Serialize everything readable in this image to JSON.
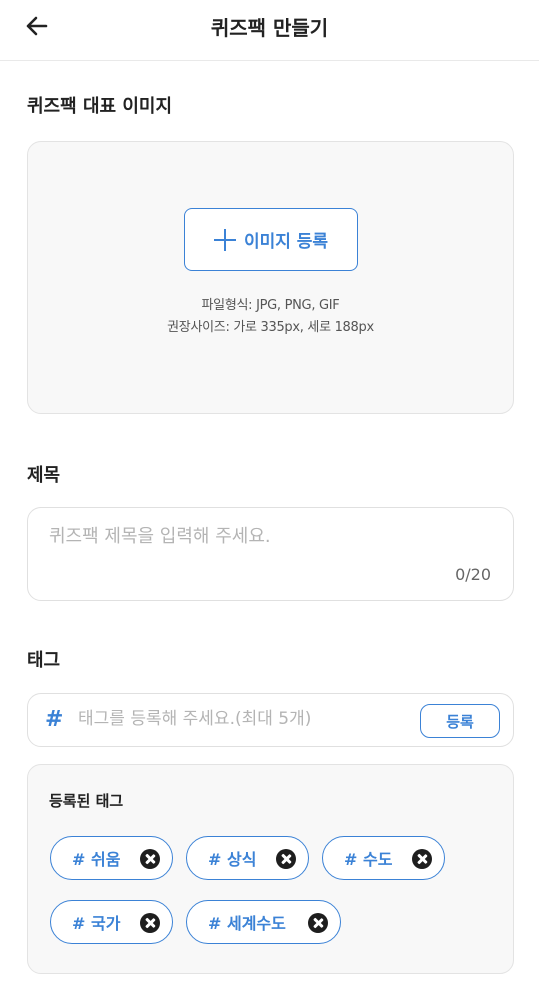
{
  "header": {
    "title": "퀴즈팩 만들기",
    "back_icon": "arrow-left-icon"
  },
  "image_section": {
    "title": "퀴즈팩 대표 이미지",
    "register_button_label": "이미지 등록",
    "hint_file_type": "파일형식: JPG, PNG, GIF",
    "hint_size": "권장사이즈: 가로 335px, 세로 188px"
  },
  "title_section": {
    "title": "제목",
    "placeholder": "퀴즈팩 제목을 입력해 주세요.",
    "value": "",
    "counter": "0/20"
  },
  "tag_section": {
    "title": "태그",
    "hash_symbol": "#",
    "placeholder": "태그를 등록해 주세요.(최대 5개)",
    "register_button_label": "등록"
  },
  "registered_tags": {
    "title": "등록된 태그",
    "tags": [
      {
        "label": "# 쉬움"
      },
      {
        "label": "# 상식"
      },
      {
        "label": "# 수도"
      },
      {
        "label": "# 국가"
      },
      {
        "label": "# 세계수도"
      }
    ]
  },
  "colors": {
    "accent": "#3b82d6",
    "panel_bg": "#f8f8f8",
    "border": "#e0e0e0"
  }
}
